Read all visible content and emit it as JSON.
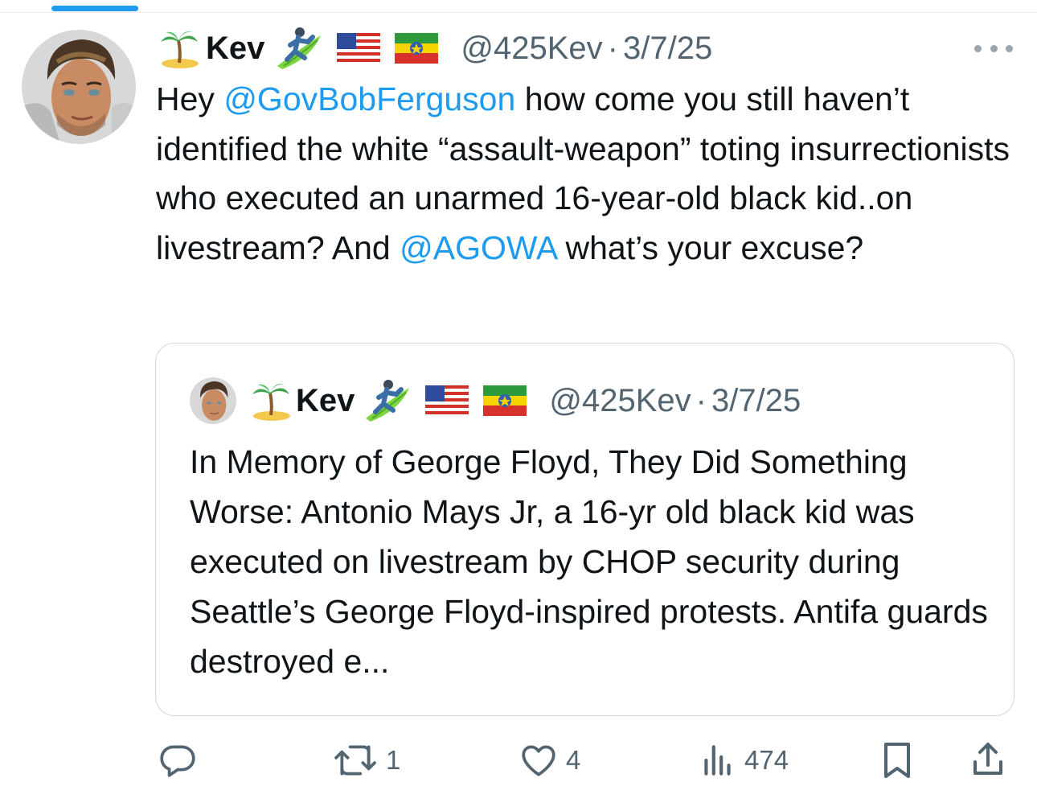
{
  "colors": {
    "accent": "#1d9bf0",
    "text": "#0f1419",
    "muted": "#536471",
    "border": "#cfd9de"
  },
  "tweet": {
    "author": {
      "display_name": "Kev",
      "handle": "@425Kev",
      "emojis_before": [
        "palm-tree-island-emoji"
      ],
      "emojis_after": [
        "surfer-emoji",
        "us-flag-emoji",
        "ethiopia-flag-emoji"
      ]
    },
    "separator": "·",
    "date": "3/7/25",
    "text": {
      "p1": "Hey ",
      "mention1": "@GovBobFerguson",
      "p2": " how come you still haven’t identified the white “assault-weapon” toting insurrectionists who executed an unarmed 16-year-old black kid..on livestream? And ",
      "mention2": "@AGOWA",
      "p3": " what’s your excuse?"
    },
    "quote": {
      "display_name": "Kev",
      "handle": "@425Kev",
      "separator": "·",
      "date": "3/7/25",
      "text": "In Memory of George Floyd, They Did Something Worse: Antonio Mays Jr, a 16-yr old black kid was executed on livestream by CHOP security during Seattle’s George Floyd-inspired protests. Antifa guards destroyed e..."
    },
    "actions": {
      "reply_count": "",
      "retweet_count": "1",
      "like_count": "4",
      "views_count": "474"
    },
    "icons": [
      "more-icon",
      "reply-icon",
      "retweet-icon",
      "like-icon",
      "views-icon",
      "bookmark-icon",
      "share-icon"
    ]
  }
}
